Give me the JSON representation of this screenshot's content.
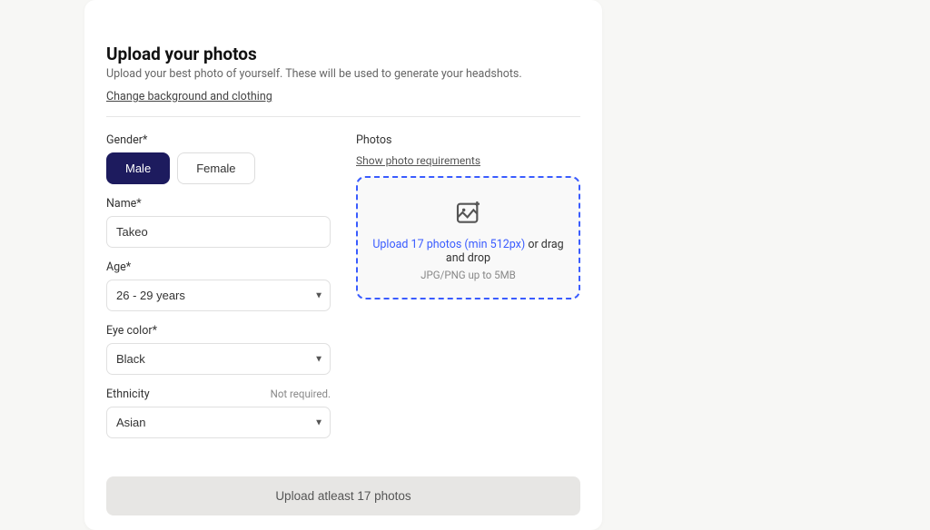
{
  "header": {
    "title": "Upload your photos",
    "subtitle": "Upload your best photo of yourself. These will be used to generate your headshots.",
    "change_link": "Change background and clothing"
  },
  "form": {
    "gender": {
      "label": "Gender*",
      "male": "Male",
      "female": "Female"
    },
    "name": {
      "label": "Name*",
      "value": "Takeo"
    },
    "age": {
      "label": "Age*",
      "value": "26 - 29 years"
    },
    "eye": {
      "label": "Eye color*",
      "value": "Black"
    },
    "ethnicity": {
      "label": "Ethnicity",
      "not_required": "Not required.",
      "value": "Asian"
    }
  },
  "photos": {
    "label": "Photos",
    "show_req": "Show photo requirements",
    "dz_link": "Upload 17 photos (min 512px)",
    "dz_tail": " or drag and drop",
    "dz_sub": "JPG/PNG up to 5MB"
  },
  "cta": "Upload atleast 17 photos"
}
